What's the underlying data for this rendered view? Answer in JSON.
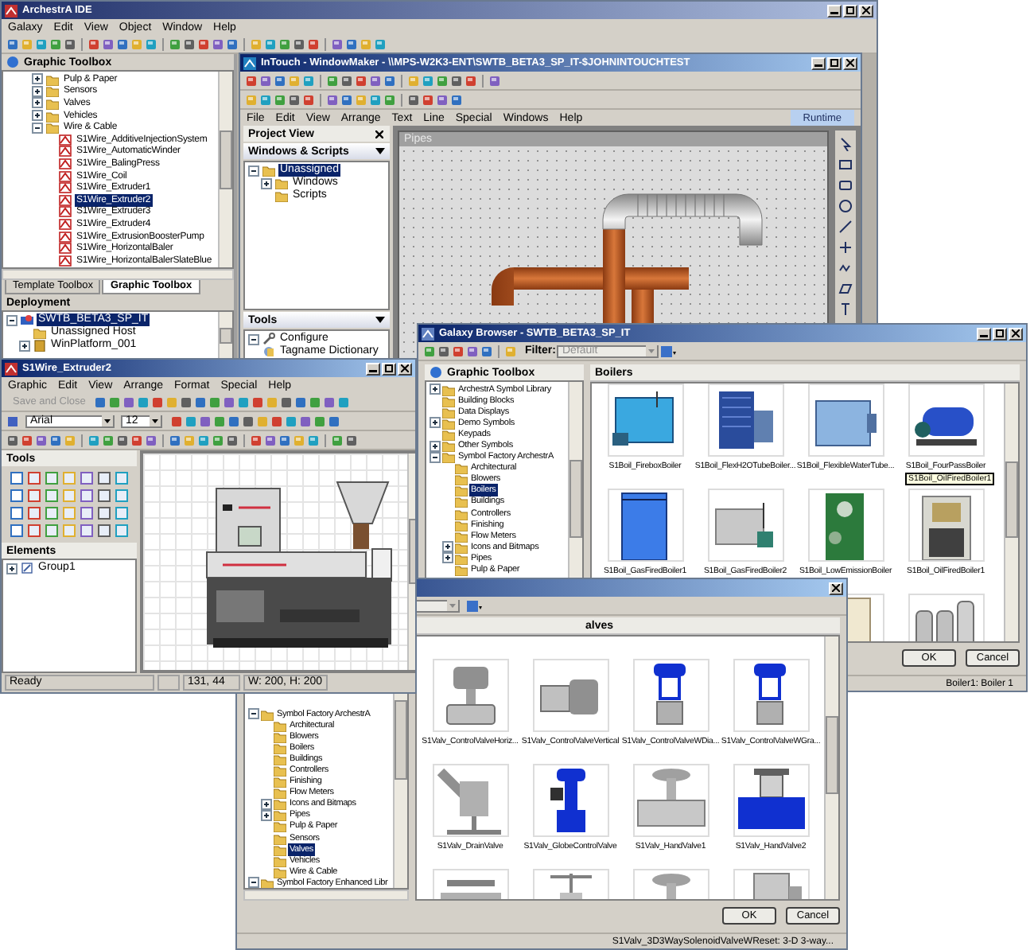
{
  "ide": {
    "title": "ArchestrA IDE",
    "menu": [
      "Galaxy",
      "Edit",
      "View",
      "Object",
      "Window",
      "Help"
    ],
    "toolbox_title": "Graphic Toolbox",
    "tree": [
      {
        "label": "Pulp & Paper",
        "kind": "folder",
        "expanded": false,
        "selected": false
      },
      {
        "label": "Sensors",
        "kind": "folder",
        "expanded": false,
        "selected": false
      },
      {
        "label": "Valves",
        "kind": "folder",
        "expanded": false,
        "selected": false
      },
      {
        "label": "Vehicles",
        "kind": "folder",
        "expanded": false,
        "selected": false
      },
      {
        "label": "Wire & Cable",
        "kind": "folder",
        "expanded": true,
        "selected": false,
        "children": [
          {
            "label": "S1Wire_AdditiveInjectionSystem",
            "kind": "symbol",
            "selected": false
          },
          {
            "label": "S1Wire_AutomaticWinder",
            "kind": "symbol",
            "selected": false
          },
          {
            "label": "S1Wire_BalingPress",
            "kind": "symbol",
            "selected": false
          },
          {
            "label": "S1Wire_Coil",
            "kind": "symbol",
            "selected": false
          },
          {
            "label": "S1Wire_Extruder1",
            "kind": "symbol",
            "selected": false
          },
          {
            "label": "S1Wire_Extruder2",
            "kind": "symbol",
            "selected": true
          },
          {
            "label": "S1Wire_Extruder3",
            "kind": "symbol",
            "selected": false
          },
          {
            "label": "S1Wire_Extruder4",
            "kind": "symbol",
            "selected": false
          },
          {
            "label": "S1Wire_ExtrusionBoosterPump",
            "kind": "symbol",
            "selected": false
          },
          {
            "label": "S1Wire_HorizontalBaler",
            "kind": "symbol",
            "selected": false
          },
          {
            "label": "S1Wire_HorizontalBalerSlateBlue",
            "kind": "symbol",
            "selected": false
          }
        ]
      }
    ],
    "tabs": [
      {
        "label": "Template Toolbox",
        "selected": false
      },
      {
        "label": "Graphic Toolbox",
        "selected": true
      }
    ],
    "deployment_title": "Deployment",
    "deployment": [
      {
        "label": "SWTB_BETA3_SP_IT",
        "kind": "galaxy",
        "expanded": true,
        "selected": true,
        "children": [
          {
            "label": "Unassigned Host",
            "kind": "folder",
            "selected": false
          },
          {
            "label": "WinPlatform_001",
            "kind": "platform",
            "expanded": false,
            "selected": false
          }
        ]
      }
    ]
  },
  "windowmaker": {
    "title": "InTouch - WindowMaker - \\\\MPS-W2K3-ENT\\SWTB_BETA3_SP_IT-$JOHNINTOUCHTEST",
    "menu": [
      "File",
      "Edit",
      "View",
      "Arrange",
      "Text",
      "Line",
      "Special",
      "Windows",
      "Help"
    ],
    "runtime": "Runtime",
    "project_view": "Project View",
    "section": "Windows & Scripts",
    "tree": [
      {
        "label": "Unassigned",
        "kind": "folder",
        "expanded": true,
        "selected": true,
        "children": [
          {
            "label": "Windows",
            "kind": "folder",
            "expanded": false,
            "selected": false
          },
          {
            "label": "Scripts",
            "kind": "folder",
            "selected": false
          }
        ]
      }
    ],
    "tools_title": "Tools",
    "tools": [
      {
        "label": "Configure",
        "kind": "wrench",
        "expanded": true,
        "selected": false
      },
      {
        "label": "Tagname Dictionary",
        "kind": "dictionary",
        "selected": false
      }
    ],
    "canvas_title": "Pipes"
  },
  "galaxy_browser": {
    "title": "Galaxy Browser - SWTB_BETA3_SP_IT",
    "filter_label": "Filter:",
    "filter_value": "Default",
    "tree_title": "Graphic Toolbox",
    "tree": [
      {
        "label": "ArchestrA Symbol Library",
        "kind": "folder",
        "expanded": false,
        "selected": false
      },
      {
        "label": "Building Blocks",
        "kind": "folder",
        "selected": false
      },
      {
        "label": "Data Displays",
        "kind": "folder",
        "selected": false
      },
      {
        "label": "Demo Symbols",
        "kind": "folder",
        "expanded": false,
        "selected": false
      },
      {
        "label": "Keypads",
        "kind": "folder",
        "selected": false
      },
      {
        "label": "Other Symbols",
        "kind": "folder",
        "expanded": false,
        "selected": false
      },
      {
        "label": "Symbol Factory ArchestrA",
        "kind": "folder",
        "expanded": true,
        "selected": false,
        "children": [
          {
            "label": "Architectural",
            "kind": "folder",
            "selected": false
          },
          {
            "label": "Blowers",
            "kind": "folder",
            "selected": false
          },
          {
            "label": "Boilers",
            "kind": "folder",
            "selected": true
          },
          {
            "label": "Buildings",
            "kind": "folder",
            "selected": false
          },
          {
            "label": "Controllers",
            "kind": "folder",
            "selected": false
          },
          {
            "label": "Finishing",
            "kind": "folder",
            "selected": false
          },
          {
            "label": "Flow Meters",
            "kind": "folder",
            "selected": false
          },
          {
            "label": "Icons and Bitmaps",
            "kind": "folder",
            "expanded": false,
            "selected": false
          },
          {
            "label": "Pipes",
            "kind": "folder",
            "expanded": false,
            "selected": false
          },
          {
            "label": "Pulp & Paper",
            "kind": "folder",
            "selected": false
          }
        ]
      }
    ],
    "pane_title": "Boilers",
    "items": [
      {
        "label": "S1Boil_FireboxBoiler",
        "kind": "firebox"
      },
      {
        "label": "S1Boil_FlexH2OTubeBoiler...",
        "kind": "flextube"
      },
      {
        "label": "S1Boil_FlexibleWaterTube...",
        "kind": "flexwater"
      },
      {
        "label": "S1Boil_FourPassBoiler",
        "kind": "fourpass"
      },
      {
        "label": "S1Boil_GasFiredBoiler1",
        "kind": "gascabinet"
      },
      {
        "label": "S1Boil_GasFiredBoiler2",
        "kind": "graybox"
      },
      {
        "label": "S1Boil_LowEmissionBoiler",
        "kind": "lowemission"
      },
      {
        "label": "S1Boil_OilFiredBoiler1",
        "kind": "oilfired"
      },
      {
        "kind": "panel"
      },
      {
        "kind": "tanks"
      }
    ],
    "tooltip": "S1Boil_OilFiredBoiler1",
    "buttons": [
      "OK",
      "Cancel"
    ],
    "status": "Boiler1: Boiler 1"
  },
  "valve_browser": {
    "pane_title": "alves",
    "tree": [
      {
        "label": "Symbol Factory ArchestrA",
        "kind": "folder",
        "expanded": true,
        "selected": false,
        "children": [
          {
            "label": "Architectural",
            "kind": "folder",
            "selected": false
          },
          {
            "label": "Blowers",
            "kind": "folder",
            "selected": false
          },
          {
            "label": "Boilers",
            "kind": "folder",
            "selected": false
          },
          {
            "label": "Buildings",
            "kind": "folder",
            "selected": false
          },
          {
            "label": "Controllers",
            "kind": "folder",
            "selected": false
          },
          {
            "label": "Finishing",
            "kind": "folder",
            "selected": false
          },
          {
            "label": "Flow Meters",
            "kind": "folder",
            "selected": false
          },
          {
            "label": "Icons and Bitmaps",
            "kind": "folder",
            "expanded": false,
            "selected": false
          },
          {
            "label": "Pipes",
            "kind": "folder",
            "expanded": false,
            "selected": false
          },
          {
            "label": "Pulp & Paper",
            "kind": "folder",
            "selected": false
          },
          {
            "label": "Sensors",
            "kind": "folder",
            "selected": false
          },
          {
            "label": "Valves",
            "kind": "folder",
            "selected": true
          },
          {
            "label": "Vehicles",
            "kind": "folder",
            "selected": false
          },
          {
            "label": "Wire & Cable",
            "kind": "folder",
            "selected": false
          }
        ]
      },
      {
        "label": "Symbol Factory Enhanced Libr",
        "kind": "folder",
        "expanded": true,
        "selected": false
      }
    ],
    "items": [
      {
        "label": "S1Valv_ControlValveHoriz...",
        "kind": "actuator"
      },
      {
        "label": "S1Valv_ControlValveVertical",
        "kind": "sideactuator"
      },
      {
        "label": "S1Valv_ControlValveWDia...",
        "kind": "bluecontrol"
      },
      {
        "label": "S1Valv_ControlValveWGra...",
        "kind": "bluecontrol"
      },
      {
        "label": "S1Valv_DrainValve",
        "kind": "drain"
      },
      {
        "label": "S1Valv_GlobeControlValve",
        "kind": "globe"
      },
      {
        "label": "S1Valv_HandValve1",
        "kind": "hand"
      },
      {
        "label": "S1Valv_HandValve2",
        "kind": "bluehand"
      },
      {
        "kind": "ball"
      },
      {
        "kind": "gate"
      },
      {
        "kind": "hand"
      },
      {
        "kind": "pipe"
      }
    ],
    "buttons": [
      "OK",
      "Cancel"
    ],
    "status": "S1Valv_3D3WaySolenoidValveWReset:  3-D  3-way..."
  },
  "symbol_editor": {
    "title": "S1Wire_Extruder2",
    "menu": [
      "Graphic",
      "Edit",
      "View",
      "Arrange",
      "Format",
      "Special",
      "Help"
    ],
    "save_label": "Save and Close",
    "font": "Arial",
    "size": "12",
    "tools_title": "Tools",
    "elements_title": "Elements",
    "elements": [
      {
        "label": "Group1",
        "kind": "group",
        "expanded": false,
        "selected": false
      }
    ],
    "status": {
      "message": "Ready",
      "position": "131, 44",
      "dimensions": "W: 200, H: 200"
    }
  }
}
